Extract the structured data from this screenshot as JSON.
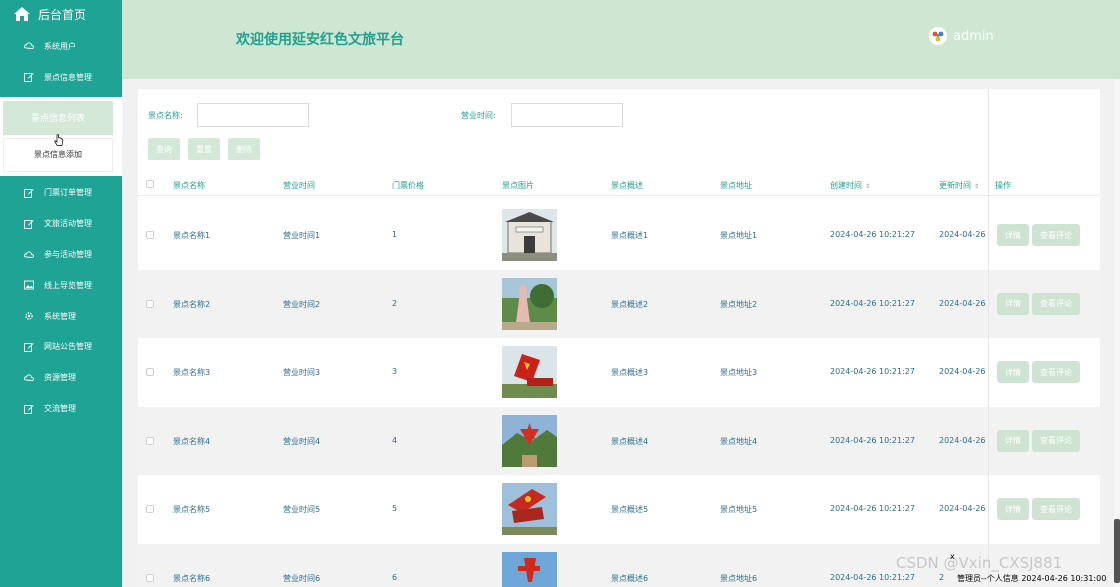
{
  "sidebar": {
    "home_label": "后台首页",
    "items": [
      {
        "label": "系统用户",
        "icon": "cloud-icon"
      },
      {
        "label": "景点信息管理",
        "icon": "edit-icon"
      }
    ],
    "submenu": {
      "active_label": "景点信息列表",
      "add_label": "景点信息添加"
    },
    "items_after": [
      {
        "label": "门票订单管理",
        "icon": "edit-icon"
      },
      {
        "label": "文旅活动管理",
        "icon": "edit-icon"
      },
      {
        "label": "参与活动管理",
        "icon": "cloud-icon"
      },
      {
        "label": "线上导览管理",
        "icon": "picture-icon"
      },
      {
        "label": "系统管理",
        "icon": "gear-icon"
      },
      {
        "label": "网站公告管理",
        "icon": "edit-icon"
      },
      {
        "label": "资源管理",
        "icon": "cloud-icon"
      },
      {
        "label": "交流管理",
        "icon": "edit-icon"
      }
    ]
  },
  "header": {
    "title": "欢迎使用延安红色文旅平台",
    "username": "admin"
  },
  "search": {
    "name_label": "景点名称:",
    "name_value": "",
    "hours_label": "营业时间:",
    "hours_value": ""
  },
  "buttons": {
    "query": "查询",
    "reset": "重置",
    "delete": "删除"
  },
  "table": {
    "headers": {
      "name": "景点名称",
      "hours": "营业时间",
      "price": "门票价格",
      "image": "景点图片",
      "summary": "景点概述",
      "address": "景点地址",
      "created": "创建时间",
      "updated": "更新时间",
      "ops": "操作"
    },
    "op_detail": "详情",
    "op_comments": "查看评论",
    "rows": [
      {
        "name": "景点名称1",
        "hours": "营业时间1",
        "price": "1",
        "summary": "景点概述1",
        "address": "景点地址1",
        "created": "2024-04-26 10:21:27",
        "updated": "2024-04-26"
      },
      {
        "name": "景点名称2",
        "hours": "营业时间2",
        "price": "2",
        "summary": "景点概述2",
        "address": "景点地址2",
        "created": "2024-04-26 10:21:27",
        "updated": "2024-04-26"
      },
      {
        "name": "景点名称3",
        "hours": "营业时间3",
        "price": "3",
        "summary": "景点概述3",
        "address": "景点地址3",
        "created": "2024-04-26 10:21:27",
        "updated": "2024-04-26"
      },
      {
        "name": "景点名称4",
        "hours": "营业时间4",
        "price": "4",
        "summary": "景点概述4",
        "address": "景点地址4",
        "created": "2024-04-26 10:21:27",
        "updated": "2024-04-26"
      },
      {
        "name": "景点名称5",
        "hours": "营业时间5",
        "price": "5",
        "summary": "景点概述5",
        "address": "景点地址5",
        "created": "2024-04-26 10:21:27",
        "updated": "2024-04-26"
      },
      {
        "name": "景点名称6",
        "hours": "营业时间6",
        "price": "6",
        "summary": "景点概述6",
        "address": "景点地址6",
        "created": "2024-04-26 10:21:27",
        "updated": "2"
      }
    ]
  },
  "status_bar": {
    "close": "x",
    "text": "管理员--个人信息 2024-04-26 10:31:00"
  },
  "watermark": "CSDN @Vxin_CXSJ881",
  "colors": {
    "sidebar": "#1ea394",
    "header": "#cfe6d3",
    "accent_text": "#22a08f",
    "button": "#d3e8d7"
  }
}
